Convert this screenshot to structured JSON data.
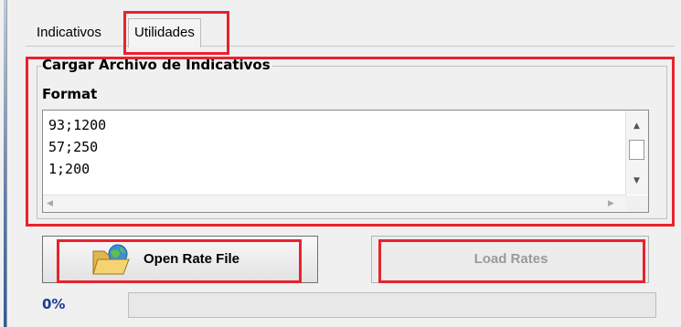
{
  "tabs": [
    {
      "label": "Indicativos",
      "active": false
    },
    {
      "label": "Utilidades",
      "active": true
    }
  ],
  "group": {
    "title": "Cargar Archivo de Indicativos",
    "format_label": "Format",
    "lines": [
      "93;1200",
      "57;250",
      "1;200"
    ]
  },
  "buttons": {
    "open_label": "Open Rate File",
    "load_label": "Load Rates",
    "load_enabled": false
  },
  "progress": {
    "label": "0%",
    "value": 0
  },
  "colors": {
    "highlight": "#e8232d",
    "progress_label": "#1a3c8c"
  },
  "icons": {
    "open_button": "folder-open-globe-icon"
  }
}
